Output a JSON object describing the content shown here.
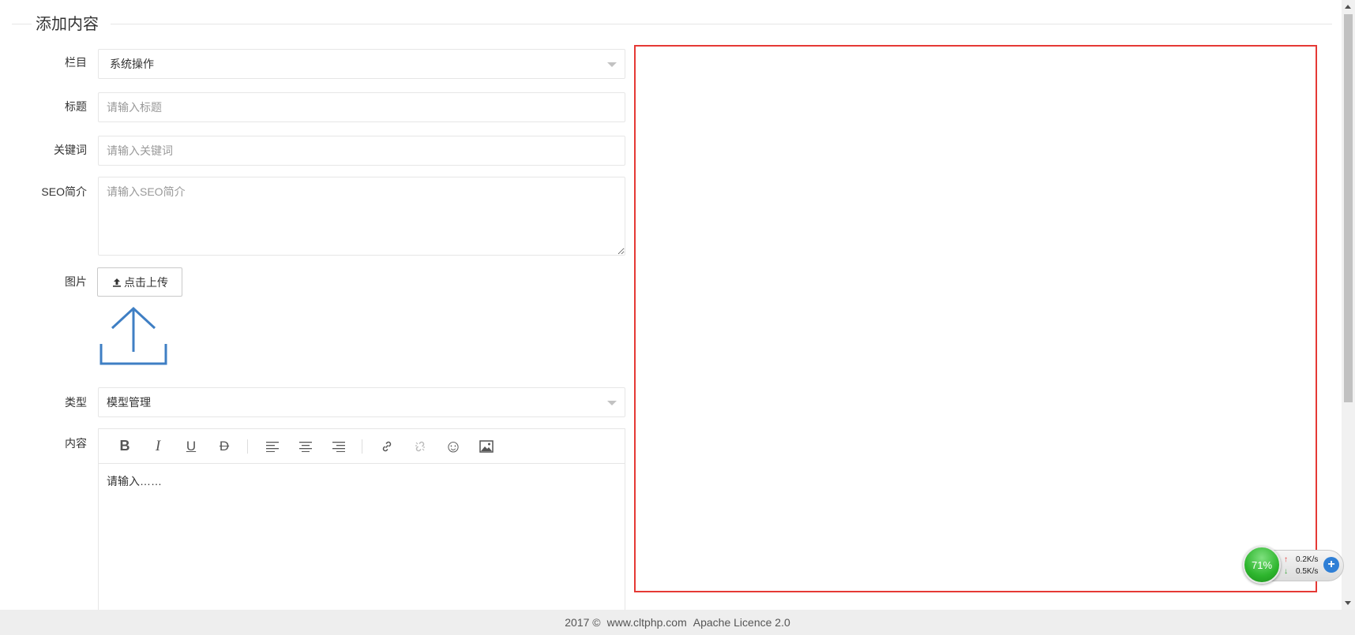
{
  "fieldset": {
    "title": "添加内容"
  },
  "form": {
    "column": {
      "label": "栏目",
      "value": "系统操作"
    },
    "title": {
      "label": "标题",
      "placeholder": "请输入标题"
    },
    "keywords": {
      "label": "关键词",
      "placeholder": "请输入关键词"
    },
    "seo": {
      "label": "SEO简介",
      "placeholder": "请输入SEO简介"
    },
    "image": {
      "label": "图片",
      "upload_label": "点击上传",
      "upload_icon": "upload-icon"
    },
    "type": {
      "label": "类型",
      "value": "模型管理"
    },
    "content": {
      "label": "内容",
      "placeholder_text": "请输入……",
      "toolbar": [
        {
          "name": "bold",
          "glyph": "B"
        },
        {
          "name": "italic",
          "glyph": "I"
        },
        {
          "name": "underline",
          "glyph": "U"
        },
        {
          "name": "strikethrough",
          "glyph": "D"
        },
        {
          "name": "align-left",
          "glyph": ""
        },
        {
          "name": "align-center",
          "glyph": ""
        },
        {
          "name": "align-right",
          "glyph": ""
        },
        {
          "name": "link",
          "glyph": ""
        },
        {
          "name": "unlink",
          "glyph": ""
        },
        {
          "name": "emoji",
          "glyph": "☺"
        },
        {
          "name": "image",
          "glyph": ""
        }
      ]
    }
  },
  "footer": {
    "copyright": "2017 ©",
    "site": "www.cltphp.com",
    "license": "Apache Licence 2.0"
  },
  "net_widget": {
    "percent": "71%",
    "upload_rate": "0.2K/s",
    "download_rate": "0.5K/s"
  },
  "colors": {
    "frame_red": "#e53935",
    "upload_blue": "#3f7fc4",
    "net_green": "#2db52d"
  }
}
